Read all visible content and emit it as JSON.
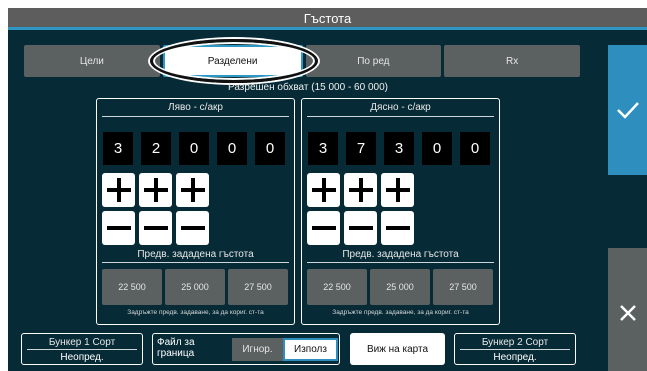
{
  "header": {
    "title": "Гъстота"
  },
  "tabs": [
    {
      "label": "Цели",
      "active": false
    },
    {
      "label": "Разделени",
      "active": true
    },
    {
      "label": "По ред",
      "active": false
    },
    {
      "label": "Rx",
      "active": false
    }
  ],
  "range_label": "Разрешен обхват (15 000 - 60 000)",
  "left_panel": {
    "title": "Ляво - с/акр",
    "digits": [
      "3",
      "2",
      "0",
      "0",
      "0"
    ],
    "plus_symbol": "+",
    "minus_symbol": "−",
    "preset_title": "Предв. зададена гъстота",
    "presets": [
      "22 500",
      "25 000",
      "27 500"
    ],
    "preset_hint": "Задръжте предв. задаване, за да кориг. ст-та"
  },
  "right_panel": {
    "title": "Дясно - с/акр",
    "digits": [
      "3",
      "7",
      "3",
      "0",
      "0"
    ],
    "plus_symbol": "+",
    "minus_symbol": "−",
    "preset_title": "Предв. зададена гъстота",
    "presets": [
      "22 500",
      "25 000",
      "27 500"
    ],
    "preset_hint": "Задръжте предв. задаване, за да кориг. ст-та"
  },
  "bin1": {
    "label": "Бункер 1 Сорт",
    "value": "Неопред."
  },
  "bin2": {
    "label": "Бункер 2 Сорт",
    "value": "Неопред."
  },
  "boundary_file": {
    "label": "Файл за граница",
    "options": [
      "Игнор.",
      "Използ"
    ],
    "selected": "Използ"
  },
  "map_button": {
    "label": "Виж на карта"
  },
  "side": {
    "confirm_icon": "checkmark-icon",
    "cancel_icon": "close-icon"
  },
  "colors": {
    "background": "#062a36",
    "accent": "#2e8fbf",
    "button_gray": "#5b6061",
    "title_bar": "#5d5d5d"
  }
}
